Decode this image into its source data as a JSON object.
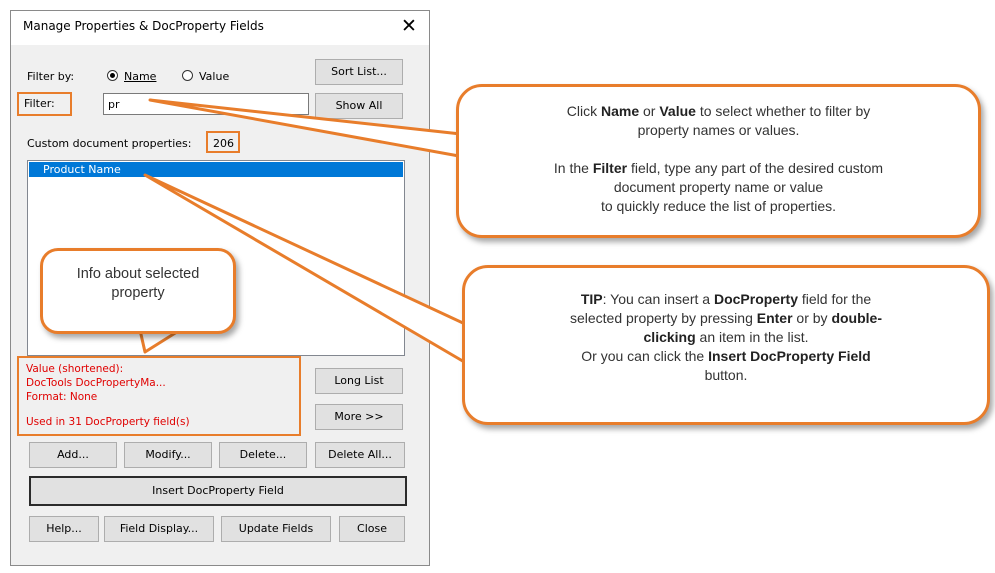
{
  "dialog": {
    "title": "Manage Properties & DocProperty Fields",
    "close_glyph": "✕",
    "filter_by_label": "Filter by:",
    "radio_name_label": "Name",
    "radio_value_label": "Value",
    "radio_selected": "Name",
    "filter_label": "Filter:",
    "filter_value": "pr",
    "sort_list_label": "Sort List...",
    "show_all_label": "Show All",
    "custom_props_label": "Custom document properties:",
    "custom_props_count": "206",
    "list_items": [
      "Product Name"
    ],
    "selected_item_index": 0,
    "info": {
      "value_label": "Value (shortened):",
      "value_text": "DocTools DocPropertyMa...",
      "format_text": "Format: None",
      "usage_text": "Used in 31 DocProperty field(s)"
    },
    "long_list_label": "Long List",
    "more_label": "More >>",
    "add_label": "Add...",
    "modify_label": "Modify...",
    "delete_label": "Delete...",
    "delete_all_label": "Delete All...",
    "insert_field_label": "Insert DocProperty Field",
    "help_label": "Help...",
    "field_display_label": "Field Display...",
    "update_fields_label": "Update Fields",
    "close_label": "Close"
  },
  "callouts": {
    "info_bubble": "Info about selected property",
    "filter_bubble": {
      "line1_pre": "Click ",
      "line1_name": "Name",
      "line1_mid": " or ",
      "line1_value": "Value",
      "line1_post": " to select whether to filter by",
      "line2": "property names or values.",
      "line3_pre": "In the ",
      "line3_filter": "Filter",
      "line3_post": " field, type any part of the desired custom",
      "line4": "document property name or value",
      "line5": "to quickly reduce the list of properties."
    },
    "tip_bubble": {
      "tip": "TIP",
      "t1": ": You can insert a ",
      "docproperty": "DocProperty",
      "t2": " field for the",
      "t3": "selected property by pressing ",
      "enter": "Enter",
      "t4": " or by ",
      "double": "double-",
      "clicking": "clicking",
      "t5": " an item in the list.",
      "t6": "Or you can click the ",
      "insert": "Insert DocProperty Field",
      "t7": "button."
    }
  },
  "colors": {
    "accent_orange": "#e87d2b",
    "selection_blue": "#0078d7",
    "info_red": "#e00000"
  }
}
